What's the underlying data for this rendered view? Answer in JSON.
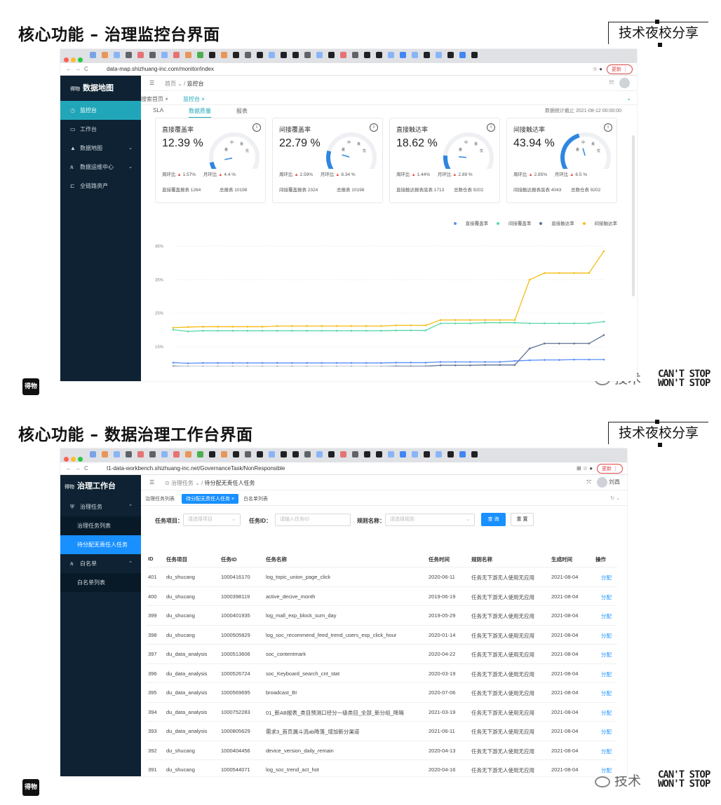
{
  "section1": {
    "title": "核心功能 – 治理监控台界面",
    "brand": "技术夜校分享",
    "side_logo": "得物",
    "watermark_wechat": "技术",
    "watermark_cant": "CAN'T STOP",
    "watermark_wont": "WON'T STOP",
    "browser": {
      "url": "data-map.shizhuang-inc.com/monitor/index",
      "update_label": "更新"
    },
    "sidebar": {
      "logo": "得物",
      "title": "数据地图",
      "items": [
        {
          "label": "监控台",
          "icon": "clock-icon"
        },
        {
          "label": "工作台",
          "icon": "monitor-icon"
        },
        {
          "label": "数据地图",
          "icon": "triangle-icon"
        },
        {
          "label": "数据运维中心",
          "icon": "users-icon"
        },
        {
          "label": "全链路资产",
          "icon": "tag-icon"
        }
      ]
    },
    "breadcrumb": {
      "home": "首页",
      "current": "监控台"
    },
    "page_tabs": [
      "搜索首页",
      "监控台"
    ],
    "sub_tabs": [
      "SLA",
      "数据质量",
      "报表"
    ],
    "stat_date": "数据统计截止 2021-08-12 00:00:00",
    "cards": [
      {
        "title": "直接覆盖率",
        "value": "12.39 %",
        "ratio": 0.1239,
        "wow_label": "周环比",
        "wow": "1.57%",
        "mom_label": "月环比",
        "mom": "4.4 %",
        "count_label": "直接覆盖报表 1264",
        "total_label": "总报表 10198"
      },
      {
        "title": "间接覆盖率",
        "value": "22.79 %",
        "ratio": 0.2279,
        "wow_label": "周环比",
        "wow": "2.59%",
        "mom_label": "月环比",
        "mom": "8.34 %",
        "count_label": "间接覆盖报表 2324",
        "total_label": "总报表 10198"
      },
      {
        "title": "直接触达率",
        "value": "18.62 %",
        "ratio": 0.1862,
        "wow_label": "周环比",
        "wow": "1.44%",
        "mom_label": "月环比",
        "mom": "2.89 %",
        "count_label": "直接触达报表底表 1713",
        "total_label": "总数仓表 9202"
      },
      {
        "title": "间接触达率",
        "value": "43.94 %",
        "ratio": 0.4394,
        "wow_label": "周环比",
        "wow": "2.85%",
        "mom_label": "月环比",
        "mom": "6.5 %",
        "count_label": "间接触达报表底表 4043",
        "total_label": "总数仓表 9202"
      }
    ],
    "gauge_labels": {
      "low": "差",
      "mid": "中",
      "good": "良",
      "excellent": "优"
    },
    "colors": {
      "accent": "#21a6b9",
      "gauge_fill": "#2f86e0",
      "sidebar_bg": "#0e2233"
    },
    "chart_data": {
      "type": "line",
      "x_count": 30,
      "y_ticks": [
        "45%",
        "35%",
        "25%",
        "15%"
      ],
      "ylim": [
        10,
        48
      ],
      "legend": [
        "直接覆盖率",
        "间接覆盖率",
        "直接触达率",
        "间接触达率"
      ],
      "legend_position": "top-right",
      "series": [
        {
          "name": "直接覆盖率",
          "color": "#5b8ff9",
          "values": [
            10.3,
            10.1,
            10.2,
            10.2,
            10.2,
            10.2,
            10.2,
            10.2,
            10.2,
            10.2,
            10.2,
            10.2,
            10.2,
            10.2,
            10.2,
            10.3,
            10.3,
            10.3,
            10.5,
            10.5,
            10.5,
            10.5,
            10.5,
            10.8,
            11.0,
            11.1,
            11.1,
            11.2,
            11.2,
            11.2
          ]
        },
        {
          "name": "间接覆盖率",
          "color": "#5ad8a6",
          "values": [
            20.1,
            19.6,
            19.8,
            19.8,
            19.8,
            19.8,
            19.8,
            19.8,
            19.8,
            19.8,
            19.8,
            19.8,
            19.8,
            19.8,
            19.8,
            19.9,
            19.9,
            19.9,
            22.0,
            22.0,
            22.0,
            22.2,
            22.2,
            22.2,
            22.0,
            22.0,
            22.0,
            22.0,
            22.0,
            22.5
          ]
        },
        {
          "name": "直接触达率",
          "color": "#5d7092",
          "values": [
            9.2,
            9.1,
            9.1,
            9.1,
            9.1,
            9.1,
            9.1,
            9.1,
            9.1,
            9.1,
            9.1,
            9.1,
            9.1,
            9.1,
            9.1,
            9.2,
            9.2,
            9.2,
            9.5,
            9.5,
            9.5,
            9.6,
            9.6,
            9.6,
            14.5,
            16.0,
            16.0,
            16.0,
            16.0,
            18.5
          ]
        },
        {
          "name": "间接触达率",
          "color": "#f6bd16",
          "values": [
            20.7,
            20.9,
            21.0,
            21.0,
            21.0,
            21.0,
            21.0,
            21.2,
            21.2,
            21.2,
            21.2,
            21.2,
            21.2,
            21.2,
            21.2,
            21.4,
            21.4,
            21.4,
            23.0,
            23.0,
            23.0,
            23.0,
            23.0,
            23.0,
            35.0,
            37.0,
            37.0,
            37.0,
            37.0,
            43.5
          ]
        }
      ]
    }
  },
  "section2": {
    "title": "核心功能 – 数据治理工作台界面",
    "brand": "技术夜校分享",
    "side_logo": "得物",
    "watermark_wechat": "技术",
    "watermark_cant": "CAN'T STOP",
    "watermark_wont": "WON'T STOP",
    "browser": {
      "url": "t1-data-workbench.shizhuang-inc.net/GovernanceTask/NonResponsible",
      "update_label": "更新"
    },
    "sidebar": {
      "logo": "得物",
      "title": "治理工作台",
      "group_label": "治理任务",
      "group_items": [
        "治理任务列表",
        "待分配无责任人任务"
      ],
      "group2_label": "白名单",
      "group2_items": [
        "白名单列表"
      ]
    },
    "breadcrumb": {
      "home": "治理任务",
      "current": "待分配无责任人任务"
    },
    "user_name": "刘昌",
    "page_tabs": [
      "治理任务列表",
      "待分配无责任人任务",
      "白名单列表"
    ],
    "filters": {
      "project_label": "任务项目：",
      "project_placeholder": "请选择项目",
      "task_id_label": "任务ID：",
      "task_id_placeholder": "请输入任务ID",
      "rule_label": "规则名称：",
      "rule_placeholder": "请选择规则",
      "query_label": "查 询",
      "reset_label": "重 置"
    },
    "table": {
      "columns": [
        "ID",
        "任务项目",
        "任务ID",
        "任务名称",
        "任务时间",
        "规则名称",
        "生成时间",
        "操作"
      ],
      "rows": [
        [
          "401",
          "du_shucang",
          "1000416170",
          "log_topic_union_page_click",
          "2020-06-11",
          "任务无下游无人使用无应用",
          "2021-08-04",
          "分配"
        ],
        [
          "400",
          "du_shucang",
          "1000398119",
          "active_decive_month",
          "2019-06-19",
          "任务无下游无人使用无应用",
          "2021-08-04",
          "分配"
        ],
        [
          "399",
          "du_shucang",
          "1000401935",
          "log_mall_exp_block_sum_day",
          "2019-05-29",
          "任务无下游无人使用无应用",
          "2021-08-04",
          "分配"
        ],
        [
          "398",
          "du_shucang",
          "1000505829",
          "log_soc_recommend_feed_trend_users_exp_click_hour",
          "2020-01-14",
          "任务无下游无人使用无应用",
          "2021-08-04",
          "分配"
        ],
        [
          "397",
          "du_data_analysis",
          "1000513606",
          "soc_contentmark",
          "2020-04-22",
          "任务无下游无人使用无应用",
          "2021-08-04",
          "分配"
        ],
        [
          "396",
          "du_data_analysis",
          "1000526724",
          "soc_Keyboard_search_cnt_stat",
          "2020-03-19",
          "任务无下游无人使用无应用",
          "2021-08-04",
          "分配"
        ],
        [
          "395",
          "du_data_analysis",
          "1000569695",
          "broadcast_BI",
          "2020-07-06",
          "任务无下游无人使用无应用",
          "2021-08-04",
          "分配"
        ],
        [
          "394",
          "du_data_analysis",
          "1000752283",
          "01_新AB报表_类目预测口径分一级类目_全部_新分组_降隔",
          "2021-03-19",
          "任务无下游无人使用无应用",
          "2021-08-04",
          "分配"
        ],
        [
          "393",
          "du_data_analysis",
          "1000805629",
          "需求3_首页漏斗流ab降落_增加新分渠道",
          "2021-06-11",
          "任务无下游无人使用无应用",
          "2021-08-04",
          "分配"
        ],
        [
          "392",
          "du_shucang",
          "1000404456",
          "device_version_daily_remain",
          "2020-04-13",
          "任务无下游无人使用无应用",
          "2021-08-04",
          "分配"
        ],
        [
          "391",
          "du_shucang",
          "1000544071",
          "log_soc_trend_act_hot",
          "2020-04-16",
          "任务无下游无人使用无应用",
          "2021-08-04",
          "分配"
        ]
      ]
    }
  }
}
